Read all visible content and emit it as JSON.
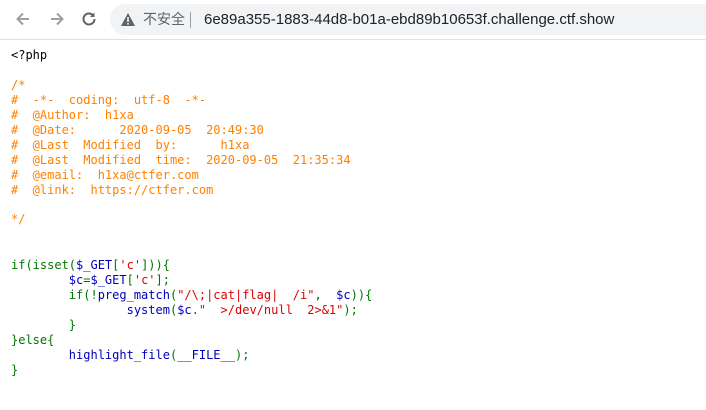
{
  "browser": {
    "security_label": "不安全",
    "url": "6e89a355-1883-44d8-b01a-ebd89b10653f.challenge.ctf.show"
  },
  "colors": {
    "comment": "#ff8000",
    "default": "#0000bb",
    "keyword": "#007700",
    "string": "#dd0000",
    "html": "#000000"
  },
  "code": {
    "open_tag": "<?php",
    "comment_open": "/*",
    "comment_lines": [
      "#  -*-  coding:  utf-8  -*-",
      "#  @Author:  h1xa",
      "#  @Date:      2020-09-05  20:49:30",
      "#  @Last  Modified  by:      h1xa",
      "#  @Last  Modified  time:  2020-09-05  21:35:34",
      "#  @email:  h1xa@ctfer.com",
      "#  @link:  https://ctfer.com"
    ],
    "comment_close": "*/",
    "l1": {
      "a": "if(isset(",
      "b": "$_GET",
      "c": "[",
      "d": "'c'",
      "e": "])){"
    },
    "l2": {
      "a": "        ",
      "b": "$c",
      "c": "=",
      "d": "$_GET",
      "e": "[",
      "f": "'c'",
      "g": "];"
    },
    "l3": {
      "a": "        if(!",
      "b": "preg_match",
      "c": "(",
      "d": "\"/\\;|cat|flag|  /i\"",
      "e": ",  ",
      "f": "$c",
      "g": ")){"
    },
    "l4": {
      "a": "                ",
      "b": "system",
      "c": "(",
      "d": "$c",
      "e": ".",
      "f": "\"  >/dev/null  2>&1\"",
      "g": ");"
    },
    "l5": "        }",
    "l6": "}else{",
    "l7": {
      "a": "        ",
      "b": "highlight_file",
      "c": "(",
      "d": "__FILE__",
      "e": ");"
    },
    "l8": "}"
  }
}
